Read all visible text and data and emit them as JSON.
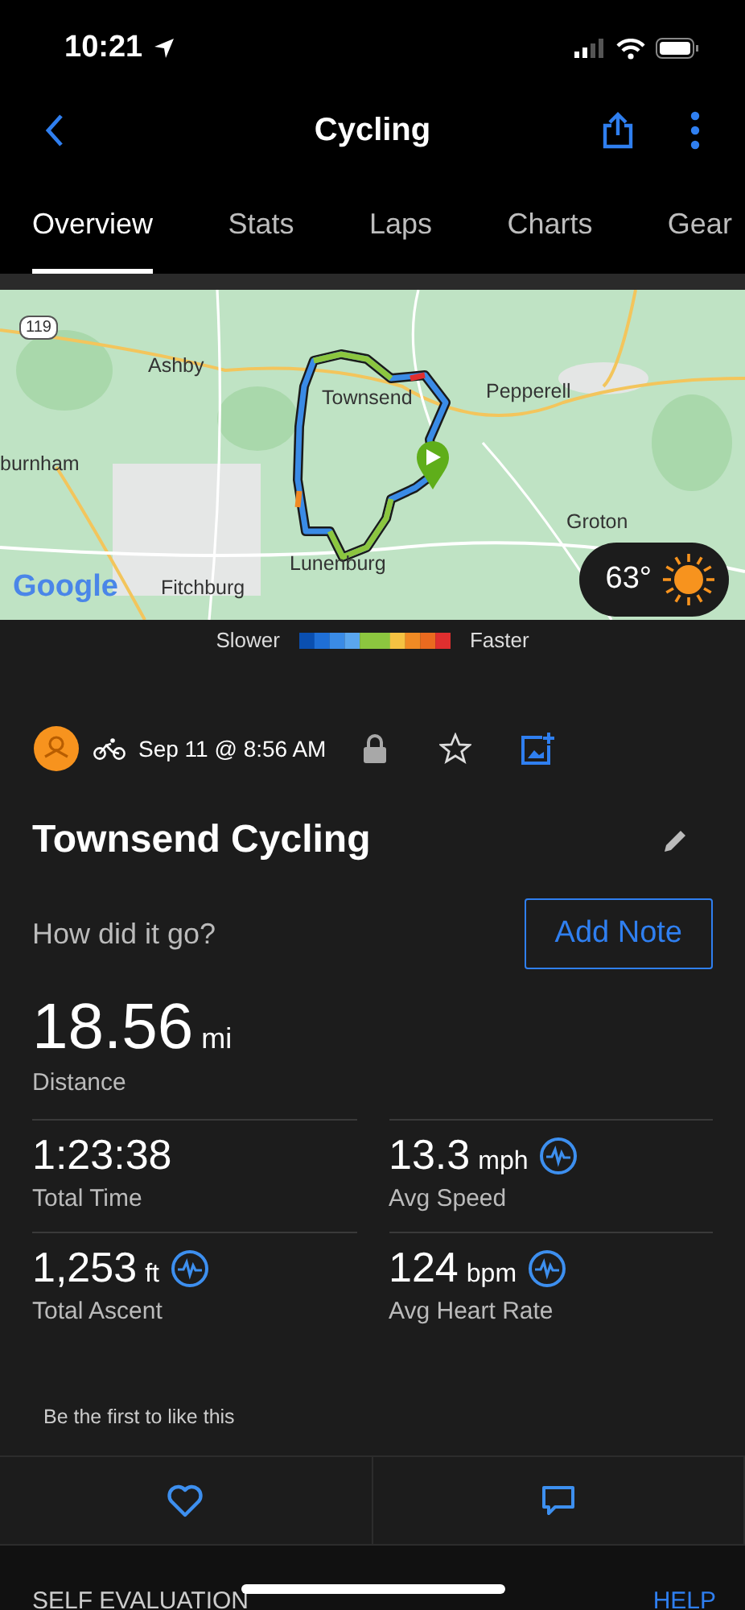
{
  "status_bar": {
    "time": "10:21"
  },
  "nav": {
    "title": "Cycling"
  },
  "tabs": [
    {
      "label": "Overview",
      "selected": true
    },
    {
      "label": "Stats",
      "selected": false
    },
    {
      "label": "Laps",
      "selected": false
    },
    {
      "label": "Charts",
      "selected": false
    },
    {
      "label": "Gear",
      "selected": false
    }
  ],
  "map": {
    "route_shield": "119",
    "labels": [
      "Ashby",
      "Townsend",
      "Pepperell",
      "burnham",
      "Groton",
      "Lunenburg",
      "Fitchburg"
    ],
    "attribution": "Google",
    "weather": {
      "temperature": "63°"
    }
  },
  "legend": {
    "slower": "Slower",
    "faster": "Faster"
  },
  "activity": {
    "date": "Sep 11 @ 8:56 AM",
    "name": "Townsend Cycling",
    "prompt": "How did it go?",
    "add_note": "Add Note"
  },
  "distance": {
    "value": "18.56",
    "unit": "mi",
    "label": "Distance"
  },
  "stats": [
    {
      "value": "1:23:38",
      "label": "Total Time",
      "has_chart": false
    },
    {
      "value": "13.3",
      "unit": "mph",
      "label": "Avg Speed",
      "has_chart": true
    },
    {
      "value": "1,253",
      "unit": "ft",
      "label": "Total Ascent",
      "has_chart": true
    },
    {
      "value": "124",
      "unit": "bpm",
      "label": "Avg Heart Rate",
      "has_chart": true
    }
  ],
  "likes": "Be the first to like this",
  "section": {
    "title": "SELF EVALUATION",
    "help": "HELP"
  }
}
